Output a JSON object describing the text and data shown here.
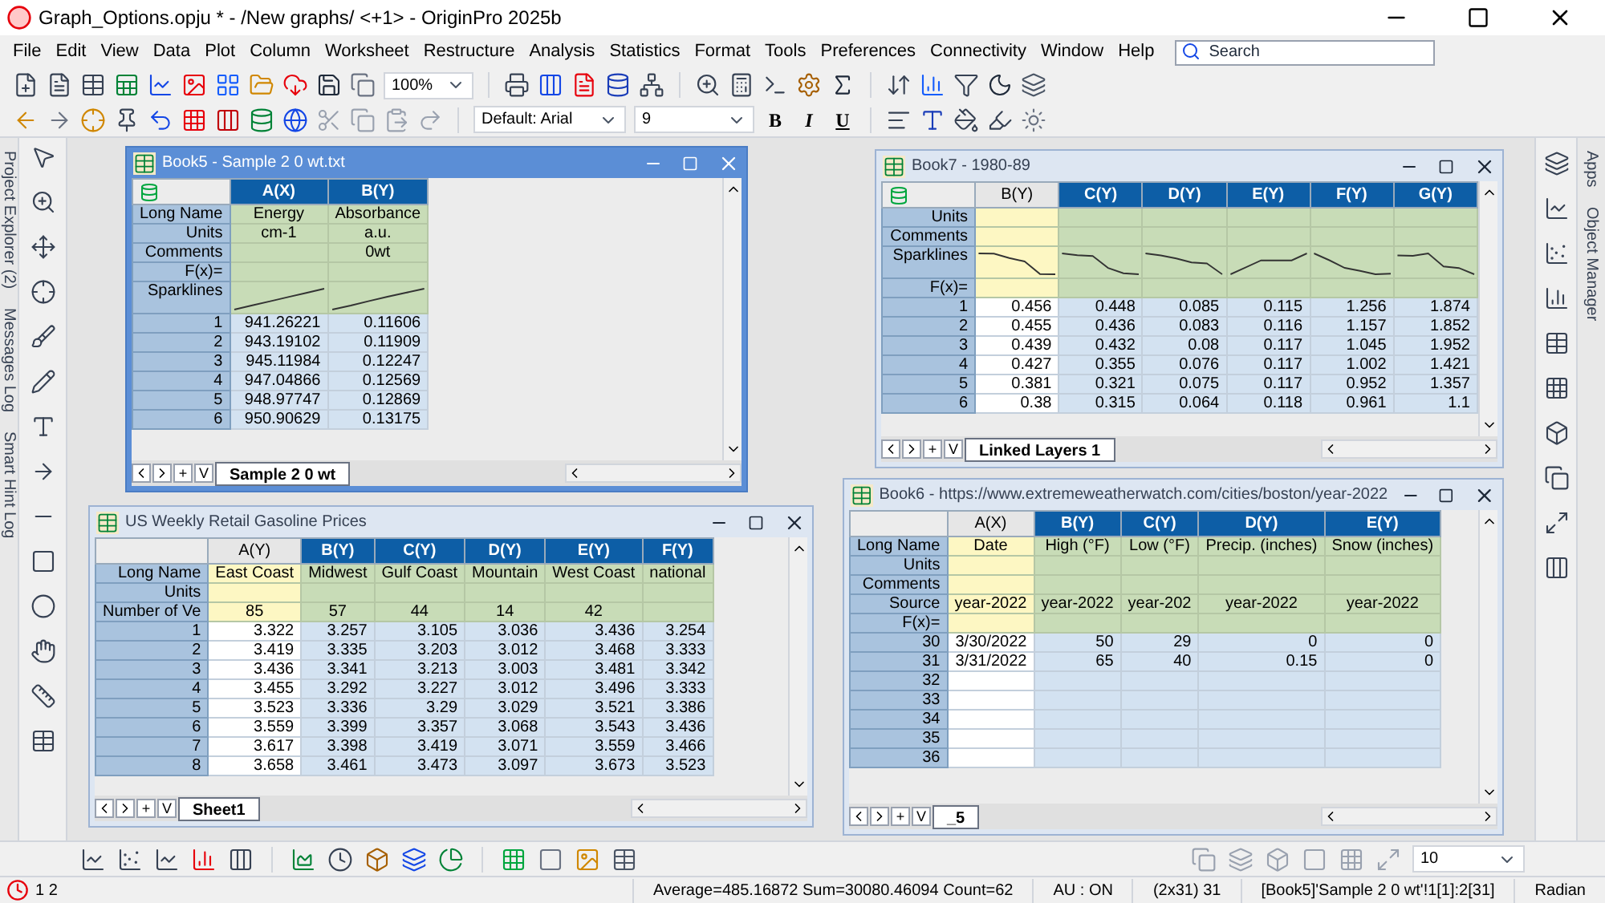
{
  "title_bar": {
    "title": "Graph_Options.opju * - /New graphs/ <+1> - OriginPro 2025b"
  },
  "menu": [
    "File",
    "Edit",
    "View",
    "Data",
    "Plot",
    "Column",
    "Worksheet",
    "Restructure",
    "Analysis",
    "Statistics",
    "Format",
    "Tools",
    "Preferences",
    "Connectivity",
    "Window",
    "Help"
  ],
  "search": {
    "placeholder": "Search"
  },
  "toolbar": {
    "zoom": "100%",
    "font": "Default: Arial",
    "font_size": "9",
    "format_buttons": [
      "B",
      "I",
      "U"
    ]
  },
  "side_tabs_left": [
    "Project Explorer (2)",
    "Messages Log",
    "Smart Hint Log"
  ],
  "side_tabs_right": [
    "Apps",
    "Object Manager"
  ],
  "windows": [
    {
      "title": "Book5 - Sample 2 0 wt.txt",
      "active": true,
      "corner_icon": true,
      "sheet": "Sample 2 0 wt",
      "sheet_nav": [
        "+",
        "V"
      ],
      "columns": [
        {
          "name": "A(X)",
          "selected": true
        },
        {
          "name": "B(Y)",
          "selected": true
        }
      ],
      "label_rows": [
        {
          "kind": "text",
          "label": "Long Name",
          "cells": [
            "Energy",
            "Absorbance"
          ]
        },
        {
          "kind": "text",
          "label": "Units",
          "cells": [
            "cm-1",
            "a.u."
          ]
        },
        {
          "kind": "text",
          "label": "Comments",
          "cells": [
            null,
            "0wt"
          ]
        },
        {
          "kind": "text",
          "label": "F(x)=",
          "cells": [
            null,
            null
          ]
        },
        {
          "kind": "sparkline",
          "label": "Sparklines"
        }
      ],
      "rows": [
        {
          "index": "1",
          "cells": [
            "941.26221",
            "0.11606"
          ]
        },
        {
          "index": "2",
          "cells": [
            "943.19102",
            "0.11909"
          ]
        },
        {
          "index": "3",
          "cells": [
            "945.11984",
            "0.12247"
          ]
        },
        {
          "index": "4",
          "cells": [
            "947.04866",
            "0.12569"
          ]
        },
        {
          "index": "5",
          "cells": [
            "948.97747",
            "0.12869"
          ]
        },
        {
          "index": "6",
          "cells": [
            "950.90629",
            "0.13175"
          ]
        }
      ]
    },
    {
      "title": "Book7 - 1980-89",
      "active": false,
      "corner_icon": true,
      "sheet": "Linked Layers 1",
      "sheet_nav": [
        "+",
        "V"
      ],
      "columns": [
        {
          "name": "B(Y)",
          "selected": false
        },
        {
          "name": "C(Y)",
          "selected": true
        },
        {
          "name": "D(Y)",
          "selected": true
        },
        {
          "name": "E(Y)",
          "selected": true
        },
        {
          "name": "F(Y)",
          "selected": true
        },
        {
          "name": "G(Y)",
          "selected": true
        }
      ],
      "label_rows": [
        {
          "kind": "text",
          "label": "Units",
          "cells": [
            null,
            null,
            null,
            null,
            null,
            null
          ]
        },
        {
          "kind": "text",
          "label": "Comments",
          "cells": [
            null,
            null,
            null,
            null,
            null,
            null
          ]
        },
        {
          "kind": "sparkline",
          "label": "Sparklines"
        },
        {
          "kind": "text",
          "label": "F(x)=",
          "cells": [
            null,
            null,
            null,
            null,
            null,
            null
          ]
        }
      ],
      "rows": [
        {
          "index": "1",
          "cells": [
            "0.456",
            "0.448",
            "0.085",
            "0.115",
            "1.256",
            "1.874"
          ]
        },
        {
          "index": "2",
          "cells": [
            "0.455",
            "0.436",
            "0.083",
            "0.116",
            "1.157",
            "1.852"
          ]
        },
        {
          "index": "3",
          "cells": [
            "0.439",
            "0.432",
            "0.08",
            "0.117",
            "1.045",
            "1.952"
          ]
        },
        {
          "index": "4",
          "cells": [
            "0.427",
            "0.355",
            "0.076",
            "0.117",
            "1.002",
            "1.421"
          ]
        },
        {
          "index": "5",
          "cells": [
            "0.381",
            "0.321",
            "0.075",
            "0.117",
            "0.952",
            "1.357"
          ]
        },
        {
          "index": "6",
          "cells": [
            "0.38",
            "0.315",
            "0.064",
            "0.118",
            "0.961",
            "1.1"
          ]
        }
      ]
    },
    {
      "title": "US Weekly Retail Gasoline Prices",
      "active": false,
      "corner_icon": false,
      "sheet": "Sheet1",
      "sheet_nav": [
        "+",
        "V"
      ],
      "columns": [
        {
          "name": "A(Y)",
          "selected": false
        },
        {
          "name": "B(Y)",
          "selected": true
        },
        {
          "name": "C(Y)",
          "selected": true
        },
        {
          "name": "D(Y)",
          "selected": true
        },
        {
          "name": "E(Y)",
          "selected": true
        },
        {
          "name": "F(Y)",
          "selected": true
        }
      ],
      "label_rows": [
        {
          "kind": "text",
          "label": "Long Name",
          "cells": [
            "East Coast",
            "Midwest",
            "Gulf Coast",
            "Mountain",
            "West Coast",
            "national"
          ]
        },
        {
          "kind": "text",
          "label": "Units",
          "cells": [
            null,
            null,
            null,
            null,
            null,
            null
          ]
        },
        {
          "kind": "text",
          "label": "Number of Ve",
          "cells": [
            "85",
            "57",
            "44",
            "14",
            "42",
            null
          ]
        }
      ],
      "rows": [
        {
          "index": "1",
          "cells": [
            "3.322",
            "3.257",
            "3.105",
            "3.036",
            "3.436",
            "3.254"
          ]
        },
        {
          "index": "2",
          "cells": [
            "3.419",
            "3.335",
            "3.203",
            "3.012",
            "3.468",
            "3.333"
          ]
        },
        {
          "index": "3",
          "cells": [
            "3.436",
            "3.341",
            "3.213",
            "3.003",
            "3.481",
            "3.342"
          ]
        },
        {
          "index": "4",
          "cells": [
            "3.455",
            "3.292",
            "3.227",
            "3.012",
            "3.496",
            "3.333"
          ]
        },
        {
          "index": "5",
          "cells": [
            "3.523",
            "3.336",
            "3.29",
            "3.029",
            "3.521",
            "3.386"
          ]
        },
        {
          "index": "6",
          "cells": [
            "3.559",
            "3.399",
            "3.357",
            "3.068",
            "3.543",
            "3.436"
          ]
        },
        {
          "index": "7",
          "cells": [
            "3.617",
            "3.398",
            "3.419",
            "3.071",
            "3.559",
            "3.466"
          ]
        },
        {
          "index": "8",
          "cells": [
            "3.658",
            "3.461",
            "3.473",
            "3.097",
            "3.673",
            "3.523"
          ]
        }
      ]
    },
    {
      "title": "Book6 - https://www.extremeweatherwatch.com/cities/boston/year-2022",
      "active": false,
      "corner_icon": false,
      "sheet": "_5",
      "sheet_nav": [
        "+",
        "V"
      ],
      "columns": [
        {
          "name": "A(X)",
          "selected": false
        },
        {
          "name": "B(Y)",
          "selected": true
        },
        {
          "name": "C(Y)",
          "selected": true
        },
        {
          "name": "D(Y)",
          "selected": true
        },
        {
          "name": "E(Y)",
          "selected": true
        }
      ],
      "label_rows": [
        {
          "kind": "text",
          "label": "Long Name",
          "cells": [
            "Date",
            "High (°F)",
            "Low (°F)",
            "Precip. (inches)",
            "Snow (inches)"
          ]
        },
        {
          "kind": "text",
          "label": "Units",
          "cells": [
            null,
            null,
            null,
            null,
            null
          ]
        },
        {
          "kind": "text",
          "label": "Comments",
          "cells": [
            null,
            null,
            null,
            null,
            null
          ]
        },
        {
          "kind": "text",
          "label": "Source",
          "cells": [
            "year-2022",
            "year-2022",
            "year-202",
            "year-2022",
            "year-2022"
          ]
        },
        {
          "kind": "text",
          "label": "F(x)=",
          "cells": [
            null,
            null,
            null,
            null,
            null
          ]
        }
      ],
      "rows": [
        {
          "index": "30",
          "cells": [
            "3/30/2022",
            "50",
            "29",
            "0",
            "0"
          ]
        },
        {
          "index": "31",
          "cells": [
            "3/31/2022",
            "65",
            "40",
            "0.15",
            "0"
          ]
        },
        {
          "index": "32",
          "cells": [
            null,
            null,
            null,
            null,
            null
          ]
        },
        {
          "index": "33",
          "cells": [
            null,
            null,
            null,
            null,
            null
          ]
        },
        {
          "index": "34",
          "cells": [
            null,
            null,
            null,
            null,
            null
          ]
        },
        {
          "index": "35",
          "cells": [
            null,
            null,
            null,
            null,
            null
          ]
        },
        {
          "index": "36",
          "cells": [
            null,
            null,
            null,
            null,
            null
          ]
        }
      ]
    }
  ],
  "bottom_toolbar": {
    "size": "10"
  },
  "status_bar": {
    "left": "1 2",
    "items": [
      "Average=485.16872 Sum=30080.46094 Count=62",
      "AU : ON",
      "(2x31) 31",
      "[Book5]'Sample 2 0 wt'!1[1]:2[31]",
      "Radian"
    ]
  }
}
